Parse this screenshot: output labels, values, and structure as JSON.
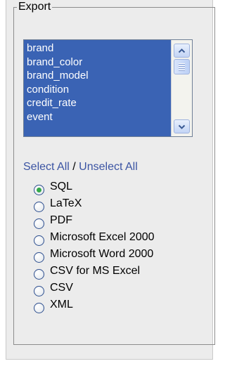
{
  "export": {
    "legend": "Export",
    "fields": [
      "brand",
      "brand_color",
      "brand_model",
      "condition",
      "credit_rate",
      "event"
    ],
    "scroll_up_icon": "arrow-up-icon",
    "scroll_down_icon": "arrow-down-icon",
    "select_all": "Select All",
    "separator": "/",
    "unselect_all": "Unselect All",
    "formats": [
      {
        "label": "SQL",
        "checked": true
      },
      {
        "label": "LaTeX",
        "checked": false
      },
      {
        "label": "PDF",
        "checked": false
      },
      {
        "label": "Microsoft Excel 2000",
        "checked": false
      },
      {
        "label": "Microsoft Word 2000",
        "checked": false
      },
      {
        "label": "CSV for MS Excel",
        "checked": false
      },
      {
        "label": "CSV",
        "checked": false
      },
      {
        "label": "XML",
        "checked": false
      }
    ]
  }
}
